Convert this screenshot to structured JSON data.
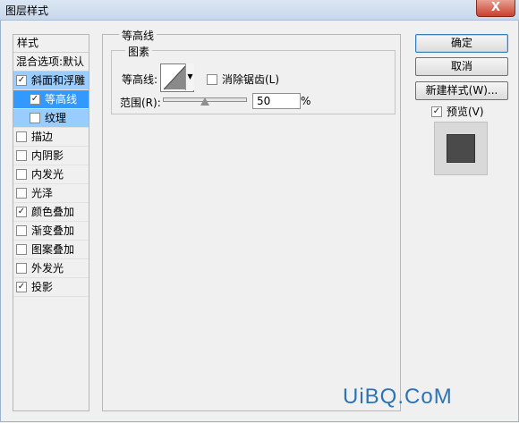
{
  "window": {
    "title": "图层样式",
    "close_label": "X"
  },
  "left_panel": {
    "header": "样式",
    "blend_options": "混合选项:默认",
    "items": [
      {
        "label": "斜面和浮雕",
        "checked": true,
        "state": "selected-light"
      },
      {
        "label": "等高线",
        "checked": true,
        "state": "selected",
        "sub": true
      },
      {
        "label": "纹理",
        "checked": false,
        "state": "selected-light",
        "sub": true
      },
      {
        "label": "描边",
        "checked": false
      },
      {
        "label": "内阴影",
        "checked": false
      },
      {
        "label": "内发光",
        "checked": false
      },
      {
        "label": "光泽",
        "checked": false
      },
      {
        "label": "颜色叠加",
        "checked": true
      },
      {
        "label": "渐变叠加",
        "checked": false
      },
      {
        "label": "图案叠加",
        "checked": false
      },
      {
        "label": "外发光",
        "checked": false
      },
      {
        "label": "投影",
        "checked": true
      }
    ]
  },
  "main": {
    "group_title": "等高线",
    "sub_group_title": "图素",
    "contour_label": "等高线:",
    "antialias_label": "消除锯齿(L)",
    "antialias_checked": false,
    "range_label": "范围(R):",
    "range_value": "50",
    "range_unit": "%"
  },
  "buttons": {
    "ok": "确定",
    "cancel": "取消",
    "new_style": "新建样式(W)...",
    "preview_label": "预览(V)",
    "preview_checked": true
  },
  "watermark": "UiBQ.CoM",
  "colors": {
    "selection": "#3399ff",
    "selection_light": "#99ccff",
    "preview_swatch": "#4a4a4a"
  }
}
